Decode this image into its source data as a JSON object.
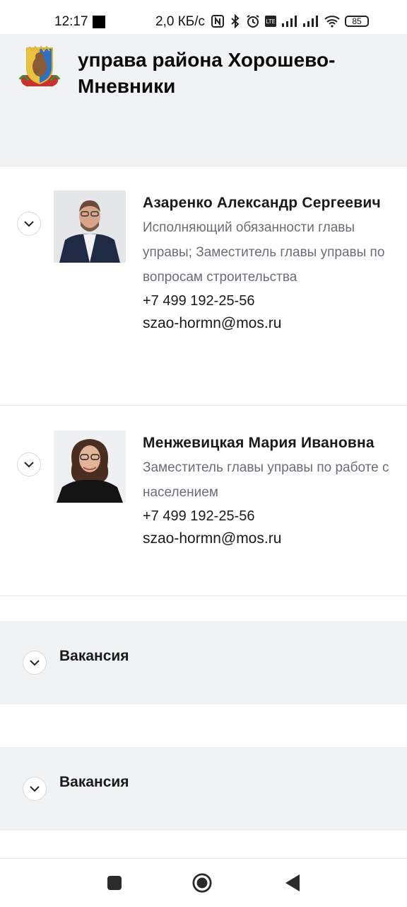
{
  "status_bar": {
    "time": "12:17",
    "speed": "2,0 КБ/с",
    "battery": "85"
  },
  "header": {
    "title": "управа района Хорошево-Мневники"
  },
  "staff": [
    {
      "name": "Азаренко Александр Сергеевич",
      "role": "Исполняющий обязанности главы управы; Заместитель главы управы по вопросам строительства",
      "phone": "+7 499 192-25-56",
      "email": "szao-hormn@mos.ru"
    },
    {
      "name": "Менжевицкая Мария Ивановна",
      "role": "Заместитель главы управы по работе с населением",
      "phone": "+7 499 192-25-56",
      "email": "szao-hormn@mos.ru"
    }
  ],
  "vacancies": [
    {
      "label": "Вакансия"
    },
    {
      "label": "Вакансия"
    }
  ],
  "icons": {
    "expand": "chevron-down-icon",
    "nav_recent": "square-icon",
    "nav_home": "circle-icon",
    "nav_back": "triangle-back-icon"
  },
  "colors": {
    "header_bg": "#f1f2f4",
    "role_text": "#6a6e74"
  }
}
